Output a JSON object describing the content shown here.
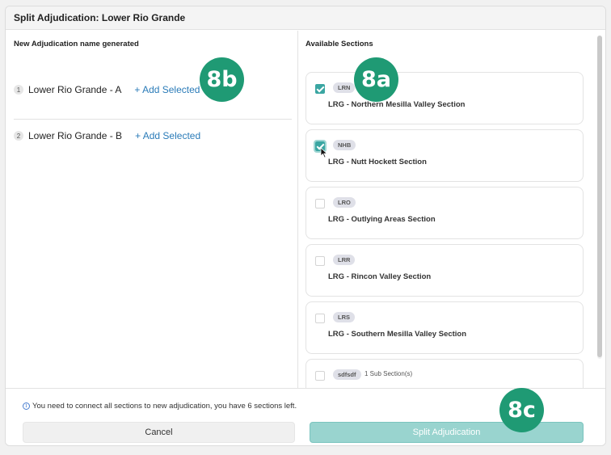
{
  "dialog": {
    "title": "Split Adjudication: Lower Rio Grande"
  },
  "left": {
    "title": "New Adjudication name generated",
    "items": [
      {
        "num": "1",
        "name": "Lower Rio Grande - A",
        "add_label": "+ Add Selected"
      },
      {
        "num": "2",
        "name": "Lower Rio Grande - B",
        "add_label": "+ Add Selected"
      }
    ]
  },
  "right": {
    "title": "Available Sections",
    "sections": [
      {
        "code": "LRN",
        "name": "LRG - Northern Mesilla Valley Section",
        "checked": true
      },
      {
        "code": "NHB",
        "name": "LRG - Nutt Hockett Section",
        "checked": true
      },
      {
        "code": "LRO",
        "name": "LRG - Outlying Areas Section",
        "checked": false
      },
      {
        "code": "LRR",
        "name": "LRG - Rincon Valley Section",
        "checked": false
      },
      {
        "code": "LRS",
        "name": "LRG - Southern Mesilla Valley Section",
        "checked": false
      },
      {
        "code": "sdfsdf",
        "name": "",
        "subsections": "1 Sub Section(s)",
        "checked": false
      }
    ]
  },
  "footer": {
    "notice": "You need to connect all sections to new adjudication, you have 6 sections left.",
    "cancel_label": "Cancel",
    "split_label": "Split Adjudication"
  },
  "annotations": [
    "8a",
    "8b",
    "8c"
  ],
  "colors": {
    "accent": "#3aa6a2",
    "annotation": "#1f9a74",
    "link": "#2a7bb8"
  }
}
